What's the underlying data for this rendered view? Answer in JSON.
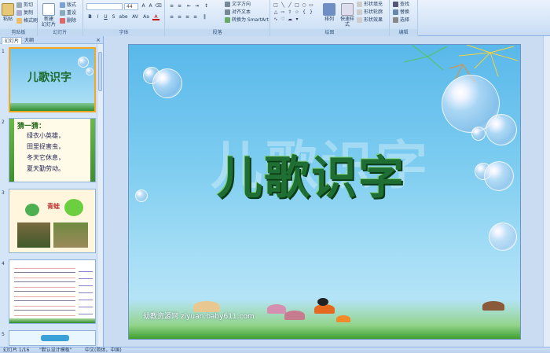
{
  "ribbon": {
    "clipboard": {
      "paste": "粘贴",
      "cut": "剪切",
      "copy": "复制",
      "format_painter": "格式刷",
      "label": "剪贴板"
    },
    "slides": {
      "new_slide": "新建\n幻灯片",
      "layout": "版式",
      "reset": "重设",
      "delete": "删除",
      "label": "幻灯片"
    },
    "font": {
      "font_name": "",
      "font_size": "44",
      "bold": "B",
      "italic": "I",
      "underline": "U",
      "strike": "S",
      "shadow": "abe",
      "spacing": "AV",
      "case": "Aa",
      "color": "A",
      "label": "字体"
    },
    "paragraph": {
      "text_direction": "文字方向",
      "align_text": "对齐文本",
      "convert_smartart": "转换为 SmartArt",
      "label": "段落"
    },
    "drawing": {
      "arrange": "排列",
      "quick_styles": "快速样式",
      "shape_fill": "形状填充",
      "shape_outline": "形状轮廓",
      "shape_effects": "形状效果",
      "label": "绘图"
    },
    "editing": {
      "find": "查找",
      "replace": "替换",
      "select": "选择",
      "label": "编辑"
    }
  },
  "left_pane": {
    "tab_slides": "幻灯片",
    "tab_outline": "大纲",
    "close": "×",
    "thumbnails": [
      {
        "num": "1",
        "title": "儿歌识字"
      },
      {
        "num": "2",
        "title": "猜一猜：",
        "lines": [
          "绿衣小英雄，",
          "田里捉害虫，",
          "冬天它休息，",
          "夏天勤劳动。"
        ]
      },
      {
        "num": "3",
        "title": "青蛙"
      },
      {
        "num": "4",
        "title": ""
      },
      {
        "num": "5",
        "title": ""
      }
    ]
  },
  "slide": {
    "title": "儿歌识字",
    "watermark": "幼教资源网 ziyuan.baby611.com"
  },
  "status_bar": {
    "slide_counter": "幻灯片 1/16",
    "theme": "\"默认设计模板\"",
    "language": "中文(简体，中国)"
  },
  "colors": {
    "accent": "#f5a623",
    "title_green": "#1f6e34",
    "ribbon": "#d3e4f7"
  }
}
